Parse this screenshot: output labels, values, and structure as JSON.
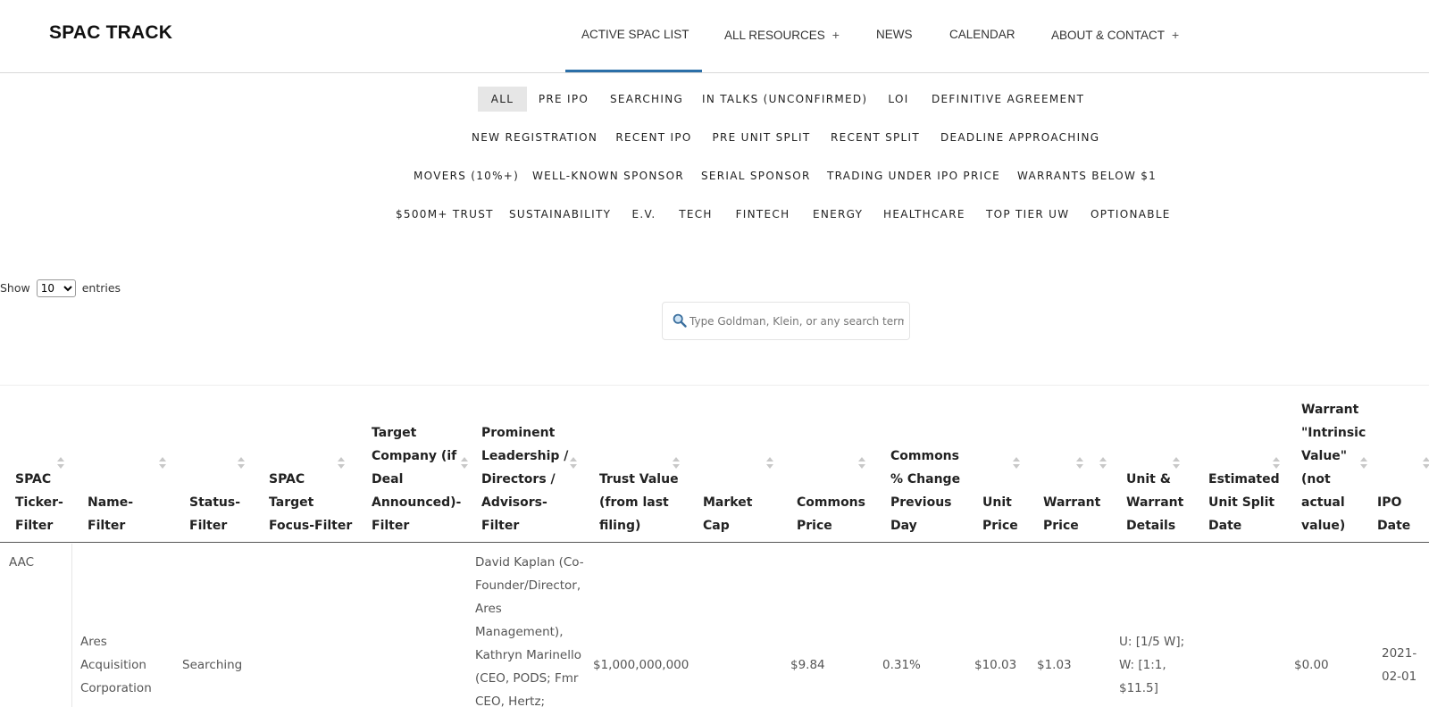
{
  "brand": {
    "logo": "SPAC TRACK",
    "accent": "#2b6fa8"
  },
  "nav": {
    "items": [
      {
        "label": "ACTIVE SPAC LIST",
        "has_plus": false,
        "active": true
      },
      {
        "label": "ALL RESOURCES",
        "has_plus": true,
        "active": false
      },
      {
        "label": "NEWS",
        "has_plus": false,
        "active": false
      },
      {
        "label": "CALENDAR",
        "has_plus": false,
        "active": false
      },
      {
        "label": "ABOUT & CONTACT",
        "has_plus": true,
        "active": false
      }
    ],
    "plus_glyph": "+"
  },
  "filters": {
    "rows": [
      [
        "ALL",
        "PRE IPO",
        "SEARCHING",
        "IN TALKS (UNCONFIRMED)",
        "LOI",
        "DEFINITIVE AGREEMENT"
      ],
      [
        "NEW REGISTRATION",
        "RECENT IPO",
        "PRE UNIT SPLIT",
        "RECENT SPLIT",
        "DEADLINE APPROACHING"
      ],
      [
        "MOVERS (10%+)",
        "WELL-KNOWN SPONSOR",
        "SERIAL SPONSOR",
        "TRADING UNDER IPO PRICE",
        "WARRANTS BELOW $1"
      ],
      [
        "$500M+ TRUST",
        "SUSTAINABILITY",
        "E.V.",
        "TECH",
        "FINTECH",
        "ENERGY",
        "HEALTHCARE",
        "TOP TIER UW",
        "OPTIONABLE"
      ]
    ],
    "active": "ALL"
  },
  "length_menu": {
    "prefix": "Show",
    "selected": "10",
    "suffix": "entries"
  },
  "search": {
    "placeholder": "Type Goldman, Klein, or any search term",
    "value": ""
  },
  "table": {
    "columns": [
      "SPAC\nTicker-\nFilter",
      "Name-\nFilter",
      "Status-\nFilter",
      "SPAC\nTarget\nFocus-Filter",
      "Target\nCompany (if\nDeal\nAnnounced)-\nFilter",
      "Prominent\nLeadership /\nDirectors /\nAdvisors-\nFilter",
      "Trust Value\n(from last\nfiling)",
      "Market\nCap",
      "Commons\nPrice",
      "Commons\n% Change\nPrevious\nDay",
      "Unit\nPrice",
      "Warrant\nPrice",
      "Unit &\nWarrant\nDetails",
      "Estimated\nUnit Split\nDate",
      "Warrant\n\"Intrinsic\nValue\"\n(not\nactual\nvalue)",
      "IPO\nDate"
    ],
    "rows": [
      {
        "ticker": "AAC",
        "name": "Ares\nAcquisition\nCorporation",
        "status": "Searching",
        "focus": "",
        "target": "",
        "leadership": "David Kaplan (Co-\nFounder/Director,\nAres\nManagement),\nKathryn Marinello\n(CEO, PODS; Fmr\nCEO, Hertz;",
        "trust_value": "$1,000,000,000",
        "market_cap": "",
        "commons_price": "$9.84",
        "commons_change": "0.31%",
        "unit_price": "$10.03",
        "warrant_price": "$1.03",
        "unit_warrant_details": "U: [1/5 W];\nW: [1:1,\n$11.5]",
        "split_date": "",
        "intrinsic_value": "$0.00",
        "ipo_date": "2021-\n02-01"
      }
    ]
  }
}
